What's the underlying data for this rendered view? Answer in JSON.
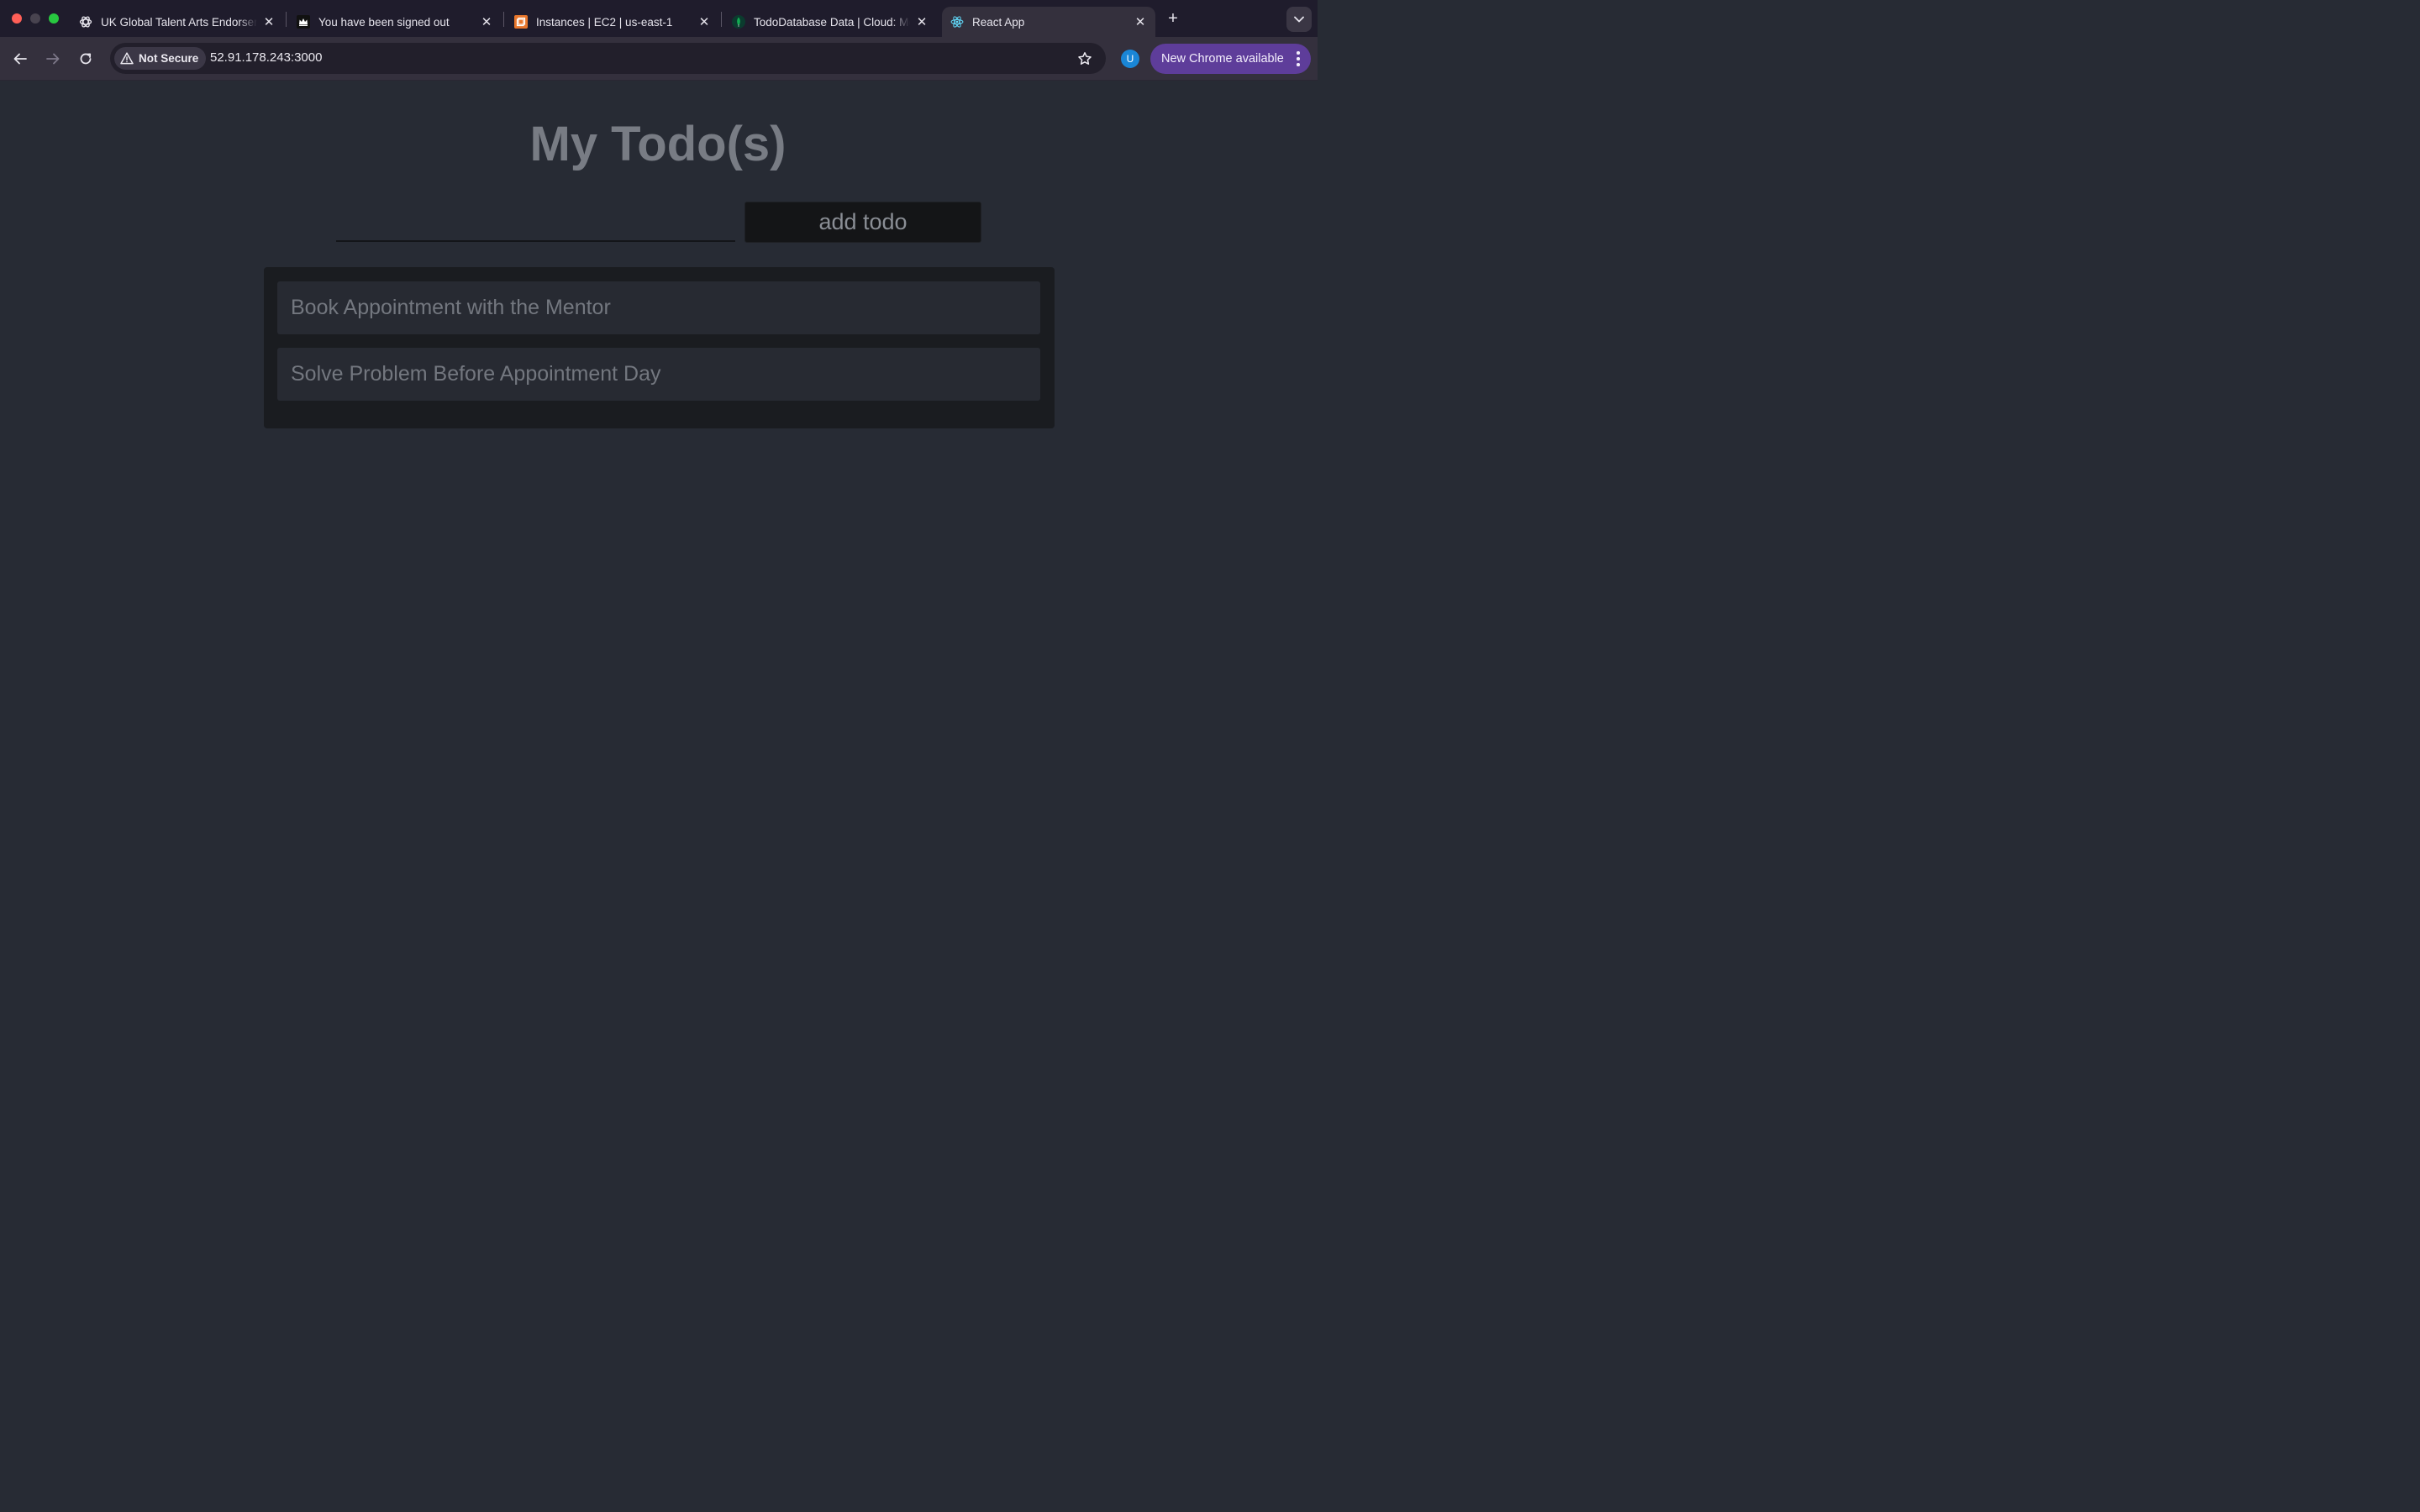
{
  "browser": {
    "tabs": [
      {
        "title": "UK Global Talent Arts Endorsement",
        "icon": "openai-icon",
        "active": false
      },
      {
        "title": "You have been signed out",
        "icon": "crown-icon",
        "active": false
      },
      {
        "title": "Instances | EC2 | us-east-1",
        "icon": "ec2-icon",
        "active": false
      },
      {
        "title": "TodoDatabase Data | Cloud: MongoDB",
        "icon": "mongodb-leaf-icon",
        "active": false
      },
      {
        "title": "React App",
        "icon": "react-icon",
        "active": true
      }
    ],
    "security_label": "Not Secure",
    "url": "52.91.178.243:3000",
    "profile_initial": "U",
    "update_label": "New Chrome available",
    "colors": {
      "update_button": "#5e3d9a",
      "avatar": "#1a86d6"
    }
  },
  "app": {
    "title": "My Todo(s)",
    "input_value": "",
    "add_button_label": "add todo",
    "todos": [
      "Book Appointment with the Mentor",
      "Solve Problem Before Appointment Day"
    ]
  }
}
